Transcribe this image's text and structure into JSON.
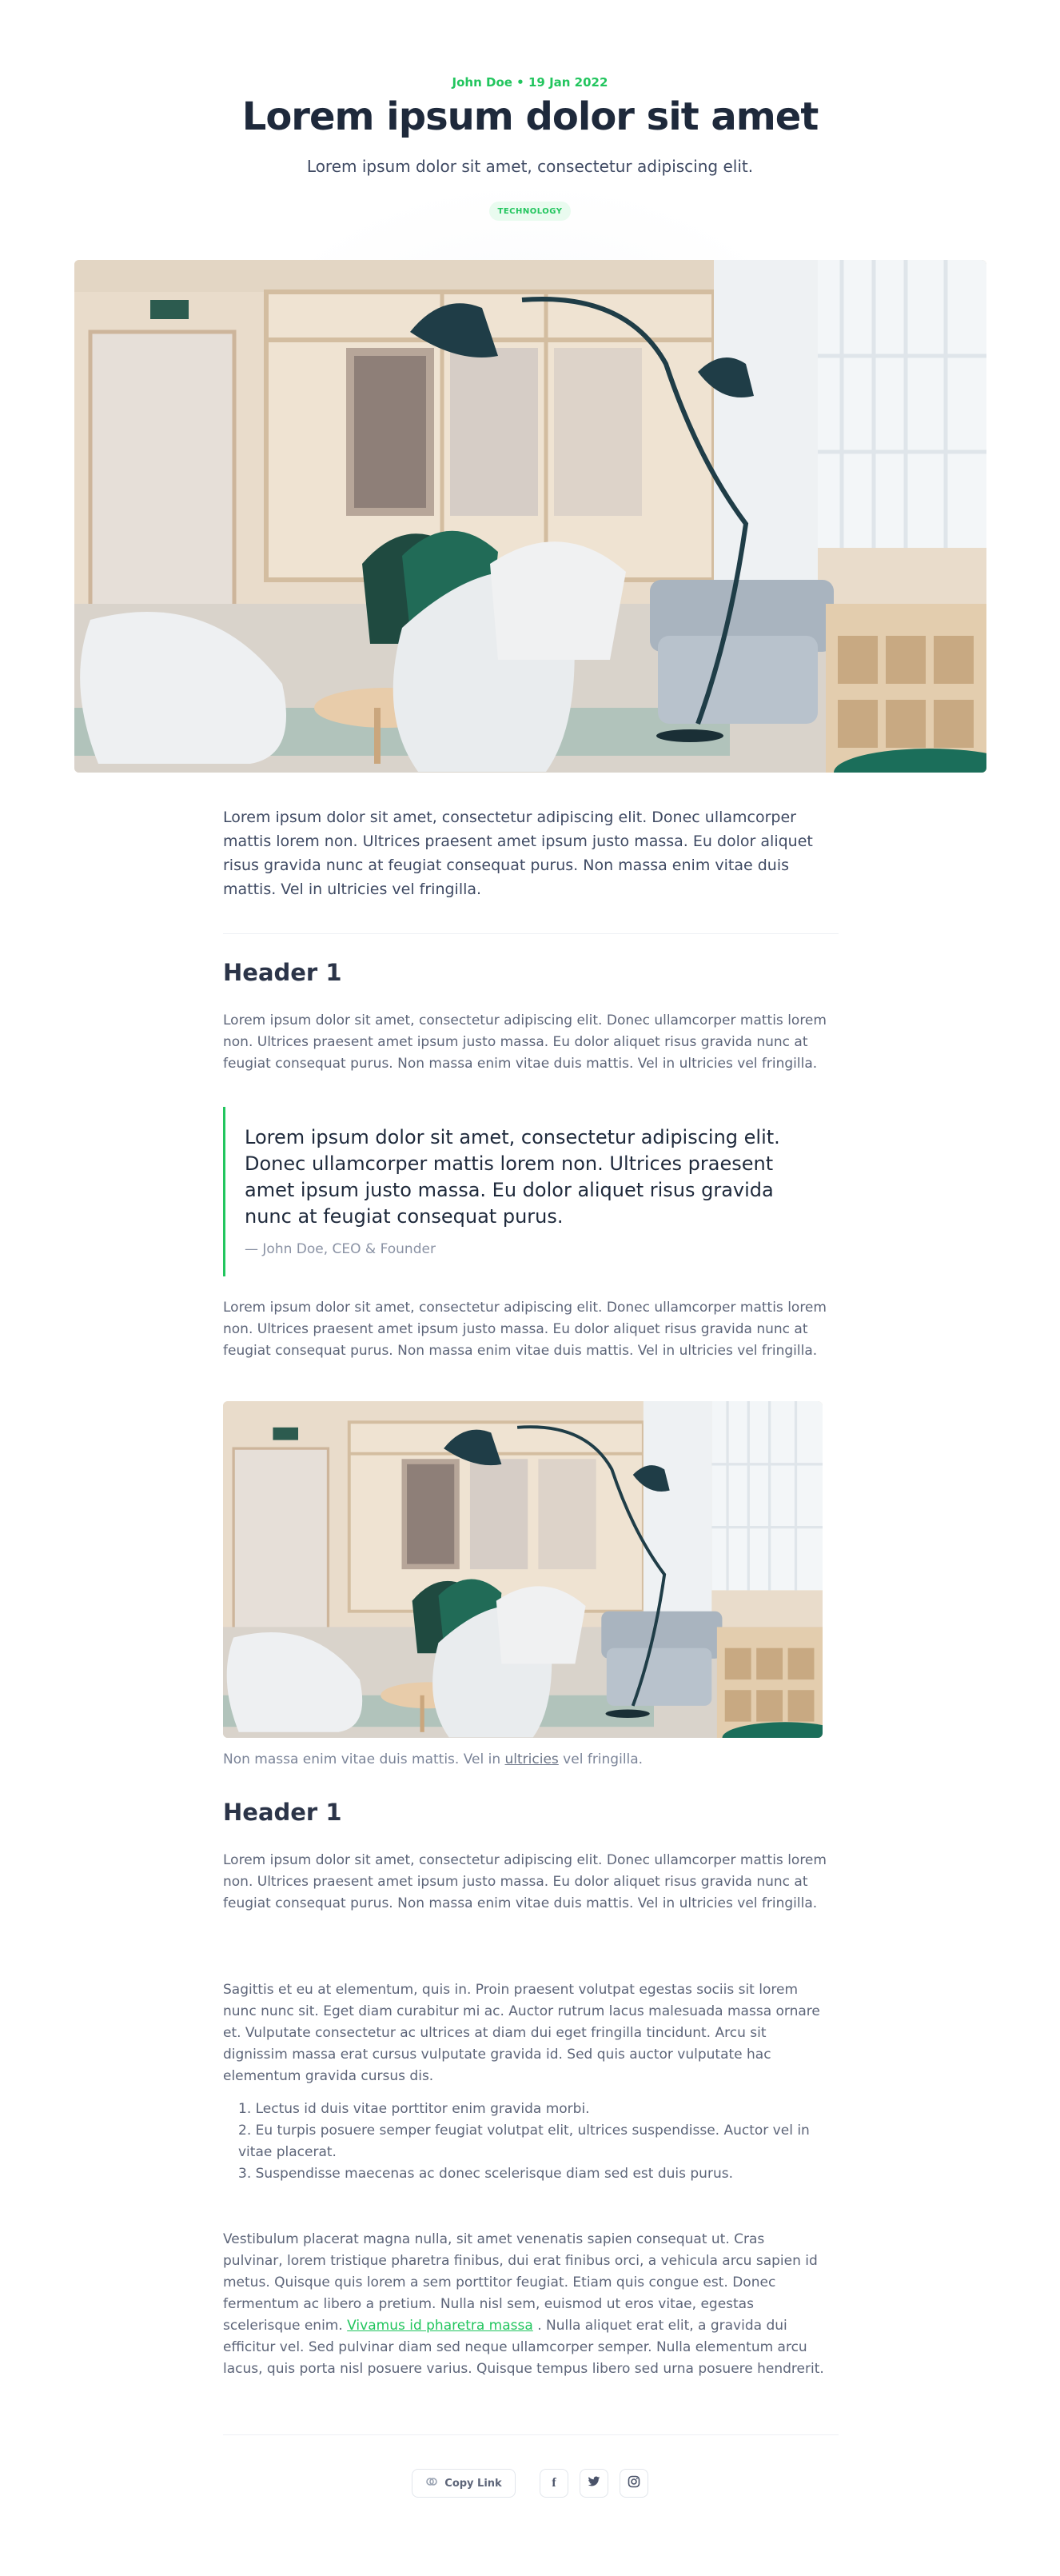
{
  "article": {
    "meta": "John Doe • 19 Jan 2022",
    "title": "Lorem ipsum dolor sit amet",
    "subtitle": "Lorem ipsum dolor sit amet, consectetur adipiscing elit.",
    "tag": "TECHNOLOGY",
    "lead": "Lorem ipsum dolor sit amet, consectetur adipiscing elit. Donec ullamcorper mattis lorem non. Ultrices praesent amet ipsum justo massa. Eu dolor aliquet risus gravida nunc at feugiat consequat purus. Non massa enim vitae duis mattis. Vel in ultricies vel fringilla."
  },
  "section1": {
    "heading": "Header 1",
    "para1": "Lorem ipsum dolor sit amet, consectetur adipiscing elit. Donec ullamcorper mattis lorem non. Ultrices praesent amet ipsum justo massa. Eu dolor aliquet risus gravida nunc at feugiat consequat purus. Non massa enim vitae duis mattis. Vel in ultricies vel fringilla.",
    "quote": "Lorem ipsum dolor sit amet, consectetur adipiscing elit. Donec ullamcorper mattis lorem non. Ultrices praesent amet ipsum justo massa. Eu dolor aliquet risus gravida nunc at feugiat consequat purus.",
    "quote_author": "— John Doe, CEO & Founder",
    "para2": "Lorem ipsum dolor sit amet, consectetur adipiscing elit. Donec ullamcorper mattis lorem non. Ultrices praesent amet ipsum justo massa. Eu dolor aliquet risus gravida nunc at feugiat consequat purus. Non massa enim vitae duis mattis. Vel in ultricies vel fringilla.",
    "caption_before": "Non massa enim vitae duis mattis. Vel in ",
    "caption_link": "ultricies",
    "caption_after": " vel fringilla."
  },
  "section2": {
    "heading": "Header 1",
    "para1": "Lorem ipsum dolor sit amet, consectetur adipiscing elit. Donec ullamcorper mattis lorem non. Ultrices praesent amet ipsum justo massa. Eu dolor aliquet risus gravida nunc at feugiat consequat purus. Non massa enim vitae duis mattis. Vel in ultricies vel fringilla.",
    "para2": "Sagittis et eu at elementum, quis in. Proin praesent volutpat egestas sociis sit lorem nunc nunc sit. Eget diam curabitur mi ac. Auctor rutrum lacus malesuada massa ornare et. Vulputate consectetur ac ultrices at diam dui eget fringilla tincidunt. Arcu sit dignissim massa erat cursus vulputate gravida id. Sed quis auctor vulputate hac elementum gravida cursus dis.",
    "list": [
      "1. Lectus id duis vitae porttitor enim gravida morbi.",
      "2. Eu turpis posuere semper feugiat volutpat elit, ultrices suspendisse. Auctor vel in vitae placerat.",
      "3. Suspendisse maecenas ac donec scelerisque diam sed est duis purus."
    ],
    "para3_before": "Vestibulum placerat magna nulla, sit amet venenatis sapien consequat ut. Cras pulvinar, lorem tristique pharetra finibus, dui erat finibus orci, a vehicula arcu sapien id metus. Quisque quis lorem a sem porttitor feugiat. Etiam quis congue est. Donec fermentum ac libero a pretium. Nulla nisl sem, euismod ut eros vitae, egestas scelerisque enim. ",
    "para3_link": "Vivamus id pharetra massa",
    "para3_after": " . Nulla aliquet erat elit, a gravida dui efficitur vel. Sed pulvinar diam sed neque ullamcorper semper. Nulla elementum arcu lacus, quis porta nisl posuere varius. Quisque tempus libero sed urna posuere hendrerit."
  },
  "share": {
    "copy_label": "Copy Link",
    "facebook_glyph": "f",
    "icons": [
      "link-icon",
      "facebook-icon",
      "twitter-icon",
      "instagram-icon"
    ]
  },
  "colors": {
    "accent": "#22c55e",
    "heading": "#1e293b",
    "body": "#5d6579"
  }
}
